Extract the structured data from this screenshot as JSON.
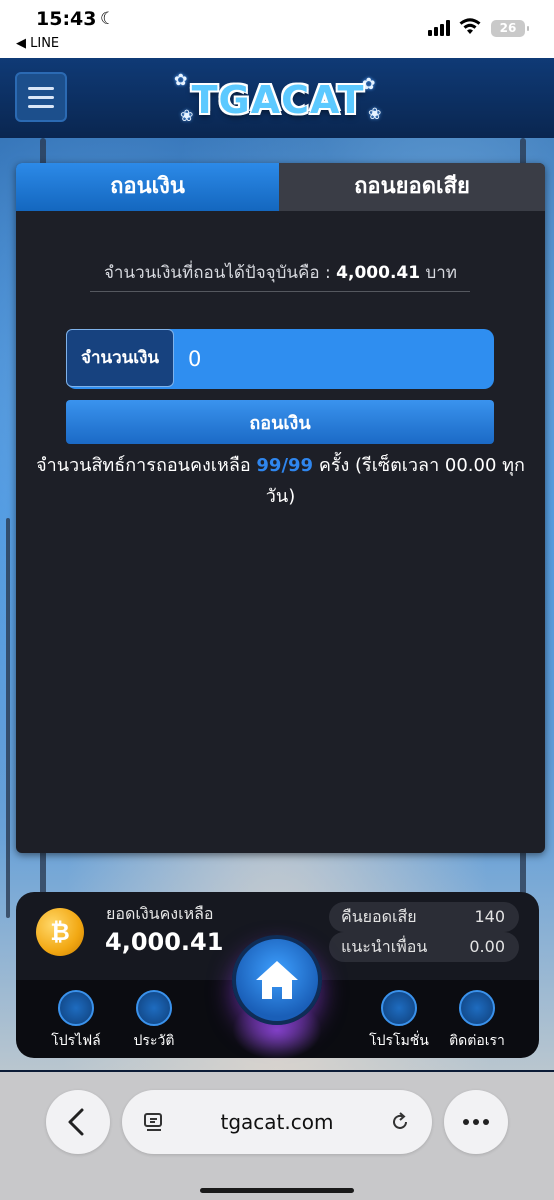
{
  "status_bar": {
    "time": "15:43",
    "back_app": "◀ LINE",
    "battery": "26"
  },
  "header": {
    "logo_text": "TGACAT"
  },
  "tabs": [
    {
      "label": "ถอนเงิน",
      "active": true
    },
    {
      "label": "ถอนยอดเสีย",
      "active": false
    }
  ],
  "withdraw": {
    "balance_prefix": "จำนวนเงินที่ถอนได้ปัจจุบันคือ :",
    "balance_value": "4,000.41",
    "balance_unit": "บาท",
    "amount_label": "จำนวนเงิน",
    "amount_value": "0",
    "submit_label": "ถอนเงิน",
    "rights_prefix": "จำนวนสิทธ์การถอนคงเหลือ",
    "rights_count": "99/99",
    "rights_suffix": "ครั้ง (รีเซ็ตเวลา 00.00 ทุกวัน)"
  },
  "wallet": {
    "label": "ยอดเงินคงเหลือ",
    "amount": "4,000.41",
    "cashback_label": "คืนยอดเสีย",
    "cashback_value": "140",
    "referral_label": "แนะนำเพื่อน",
    "referral_value": "0.00"
  },
  "bottom_nav": {
    "profile": "โปรไฟล์",
    "history": "ประวัติ",
    "promotion": "โปรโมชั่น",
    "contact": "ติดต่อเรา"
  },
  "browser": {
    "url": "tgacat.com"
  },
  "colors": {
    "accent": "#2f8ef0",
    "highlight": "#2f86ee",
    "panel_bg": "#1d1f27"
  }
}
